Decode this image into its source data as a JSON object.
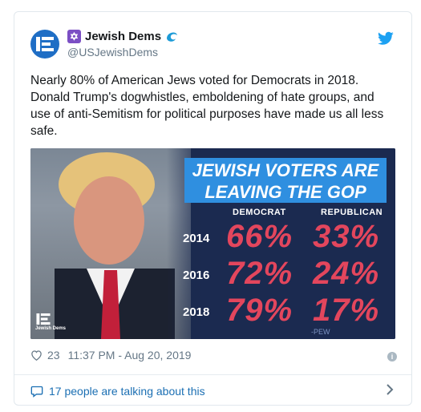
{
  "account": {
    "display_name": "Jewish Dems",
    "handle": "@USJewishDems",
    "emoji_star": "✡",
    "avatar_icon": "jewish-dems-logo-icon"
  },
  "tweet": {
    "text": "Nearly 80% of American Jews voted for Democrats in 2018. Donald Trump's dogwhistles, emboldening of hate groups, and use of anti-Semitism for political purposes have made us all less safe."
  },
  "media": {
    "headline_line1": "JEWISH VOTERS ARE",
    "headline_line2": "LEAVING THE GOP",
    "col_democrat": "DEMOCRAT",
    "col_republican": "REPUBLICAN",
    "rows": [
      {
        "year": "2014",
        "dem": "66%",
        "rep": "33%"
      },
      {
        "year": "2016",
        "dem": "72%",
        "rep": "24%"
      },
      {
        "year": "2018",
        "dem": "79%",
        "rep": "17%"
      }
    ],
    "source": "-PEW",
    "logo_text": "Jewish Dems",
    "colors": {
      "panel": "#1b2a50",
      "accent": "#2f8fe0",
      "numbers": "#e3465d"
    }
  },
  "meta": {
    "likes": "23",
    "timestamp": "11:37 PM - Aug 20, 2019"
  },
  "footer": {
    "talking": "17 people are talking about this"
  }
}
